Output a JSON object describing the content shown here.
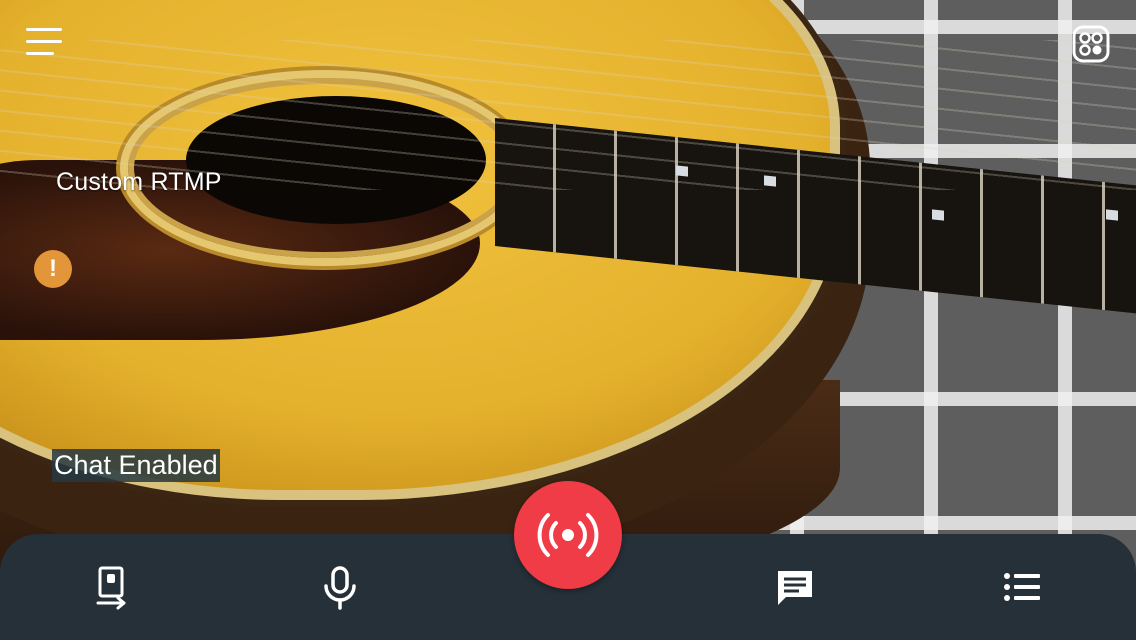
{
  "stream": {
    "service_name": "Custom RTMP",
    "chat_status": "Chat Enabled",
    "warning_icon": "exclamation-icon"
  },
  "toolbar": {
    "menu_icon": "hamburger-menu-icon",
    "camera_switch_icon": "switch-camera-icon"
  },
  "bottom_bar": {
    "items": [
      {
        "icon": "phone-orientation-icon"
      },
      {
        "icon": "microphone-icon"
      },
      {
        "icon": "broadcast-icon"
      },
      {
        "icon": "chat-icon"
      },
      {
        "icon": "list-icon"
      }
    ]
  },
  "colors": {
    "bottom_bar": "#263039",
    "live_button": "#f03c47",
    "warning": "#e3953a",
    "chat_label_bg": "#263842"
  }
}
